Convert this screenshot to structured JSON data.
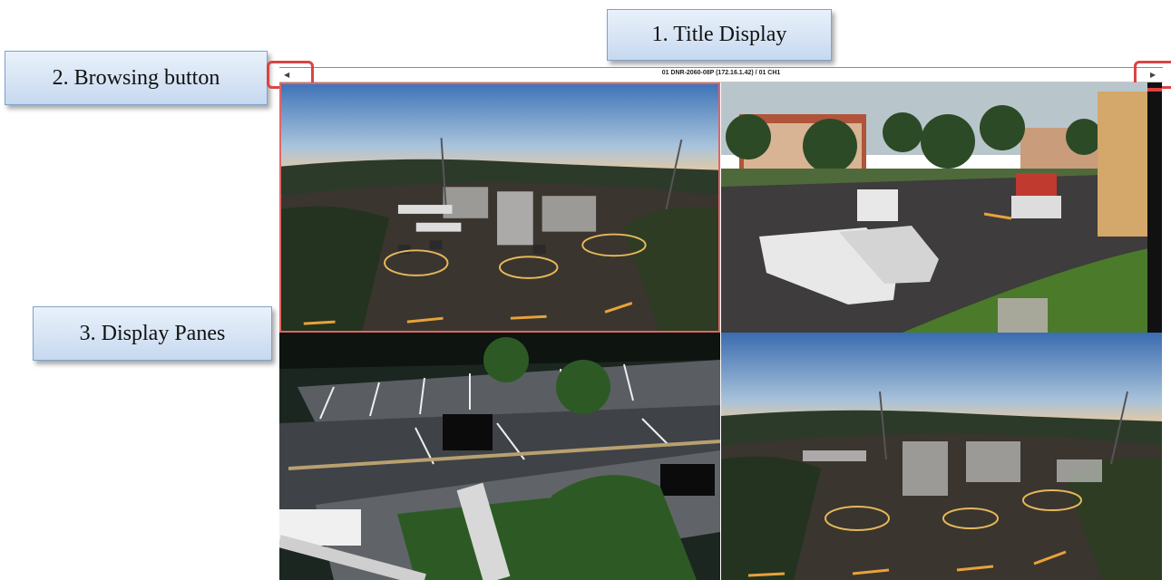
{
  "callouts": {
    "title_display": "1. Title Display",
    "browsing_button": "2. Browsing button",
    "display_panes": "3. Display Panes"
  },
  "title_bar": {
    "text": "01 DNR-2060-08P (172.16.1.42) / 01 CH1",
    "prev_icon": "◀",
    "next_icon": "▶"
  },
  "panes": [
    {
      "name": "fisheye parking lot daytime",
      "selected": true
    },
    {
      "name": "apartment parking lot with trucks",
      "selected": false
    },
    {
      "name": "parking lot at night",
      "selected": false
    },
    {
      "name": "fisheye parking lot daytime",
      "selected": false
    }
  ],
  "colors": {
    "selected_border": "#e06666",
    "highlight": "#d94545",
    "callout_fill": "#c7d9ef"
  }
}
